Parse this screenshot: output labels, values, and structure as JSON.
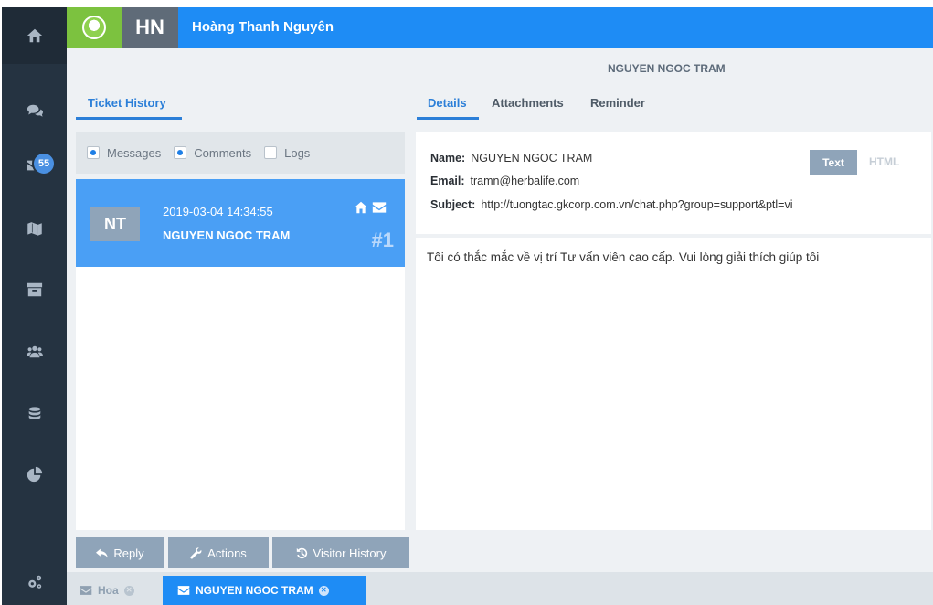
{
  "header": {
    "initials": "HN",
    "user_name": "Hoàng Thanh Nguyên"
  },
  "sidebar": {
    "badge_count": "55",
    "items": [
      "home-icon",
      "chat-icon",
      "mail-icon",
      "map-icon",
      "archive-icon",
      "users-icon",
      "database-icon",
      "pie-chart-icon",
      "settings-icon"
    ]
  },
  "visitor": {
    "name": "NGUYEN NGOC TRAM"
  },
  "left_panel": {
    "tab_label": "Ticket History",
    "filters": [
      {
        "label": "Messages",
        "checked": true
      },
      {
        "label": "Comments",
        "checked": true
      },
      {
        "label": "Logs",
        "checked": false
      }
    ],
    "tickets": [
      {
        "initials": "NT",
        "datetime": "2019-03-04 14:34:55",
        "name": "NGUYEN NGOC TRAM",
        "number": "#1"
      }
    ]
  },
  "right_panel": {
    "tabs": [
      "Details",
      "Attachments",
      "Reminder"
    ],
    "details": {
      "name_label": "Name:",
      "name_value": "NGUYEN NGOC TRAM",
      "email_label": "Email:",
      "email_value": "tramn@herbalife.com",
      "subject_label": "Subject:",
      "subject_value": "http://tuongtac.gkcorp.com.vn/chat.php?group=support&ptl=vi",
      "text_button": "Text",
      "html_button": "HTML"
    },
    "message": "Tôi có thắc mắc về vị trí Tư vấn viên cao cấp. Vui lòng giải thích giúp tôi"
  },
  "actions": {
    "reply": "Reply",
    "actions": "Actions",
    "visitor_history": "Visitor History"
  },
  "bottom_tabs": [
    {
      "label": "Hoa",
      "active": false
    },
    {
      "label": "NGUYEN NGOC TRAM",
      "active": true
    }
  ],
  "colors": {
    "topbar": "#1e8cf5",
    "sidebar": "#253341",
    "logo": "#7cc23f",
    "ticket_active": "#4a9ff5",
    "button": "#8fa4b9"
  }
}
